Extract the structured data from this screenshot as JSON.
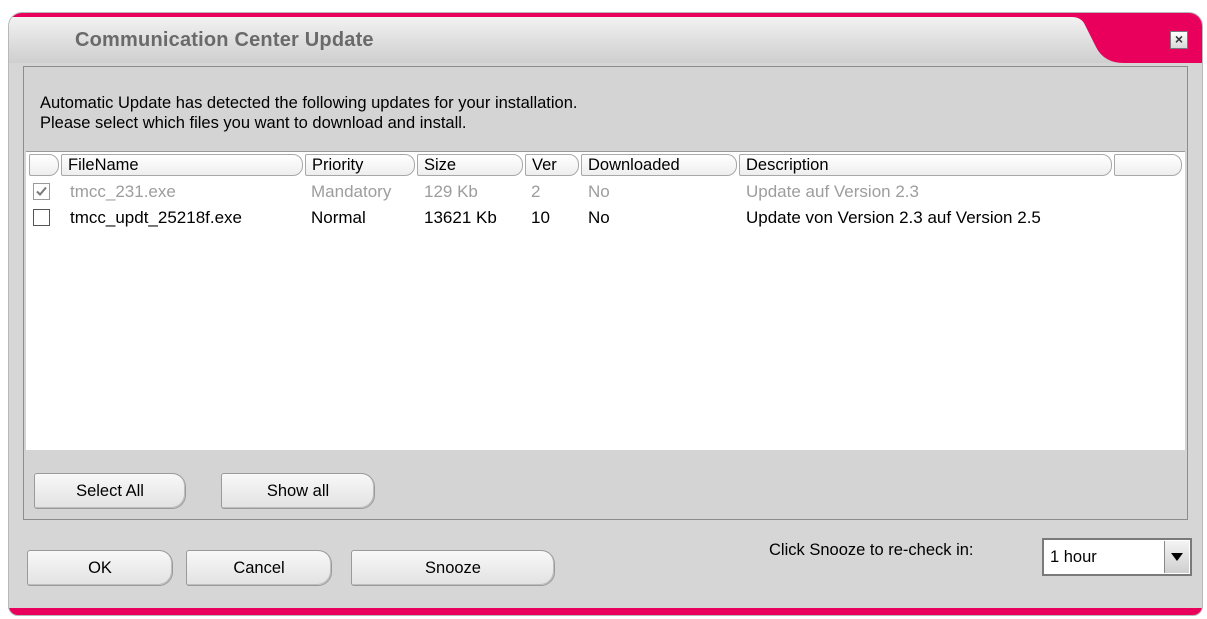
{
  "window": {
    "title": "Communication Center Update",
    "close_glyph": "×",
    "accent_color": "#e8005c"
  },
  "intro": {
    "line1": "Automatic Update has detected the following updates for your installation.",
    "line2": "Please select which files you want to download and install."
  },
  "table": {
    "columns": [
      "FileName",
      "Priority",
      "Size",
      "Ver",
      "Downloaded",
      "Description"
    ],
    "rows": [
      {
        "checked": true,
        "disabled": true,
        "filename": "tmcc_231.exe",
        "priority": "Mandatory",
        "size": "129 Kb",
        "ver": "2",
        "downloaded": "No",
        "description": "Update auf Version 2.3"
      },
      {
        "checked": false,
        "disabled": false,
        "filename": "tmcc_updt_25218f.exe",
        "priority": "Normal",
        "size": "13621 Kb",
        "ver": "10",
        "downloaded": "No",
        "description": "Update von Version 2.3 auf Version 2.5"
      }
    ]
  },
  "list_buttons": {
    "select_all": "Select All",
    "show_all": "Show all"
  },
  "footer": {
    "ok": "OK",
    "cancel": "Cancel",
    "snooze": "Snooze",
    "snooze_label": "Click Snooze to re-check in:",
    "snooze_value": "1 hour"
  }
}
